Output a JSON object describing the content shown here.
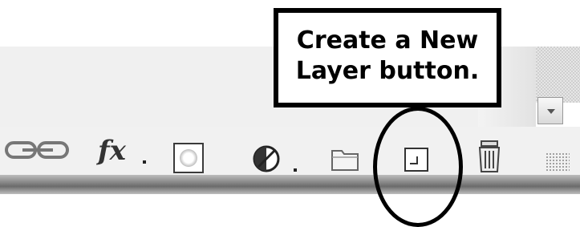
{
  "panel": {
    "scroll_arrow_icon": "scroll-down-arrow-icon"
  },
  "toolbar": {
    "buttons": [
      {
        "name": "link-layers-button",
        "icon": "chain-link-icon"
      },
      {
        "name": "add-layer-style-button",
        "icon": "fx-icon",
        "label": "fx"
      },
      {
        "name": "add-layer-mask-button",
        "icon": "mask-icon"
      },
      {
        "name": "new-adjustment-layer-button",
        "icon": "half-circle-icon"
      },
      {
        "name": "new-group-button",
        "icon": "folder-icon"
      },
      {
        "name": "create-new-layer-button",
        "icon": "new-layer-icon"
      },
      {
        "name": "delete-layer-button",
        "icon": "trash-icon"
      }
    ],
    "fx_label": "fx"
  },
  "callout": {
    "line1": "Create a New",
    "line2": "Layer button."
  },
  "colors": {
    "panel_bg": "#f0f0f0",
    "annotation": "#000000"
  }
}
